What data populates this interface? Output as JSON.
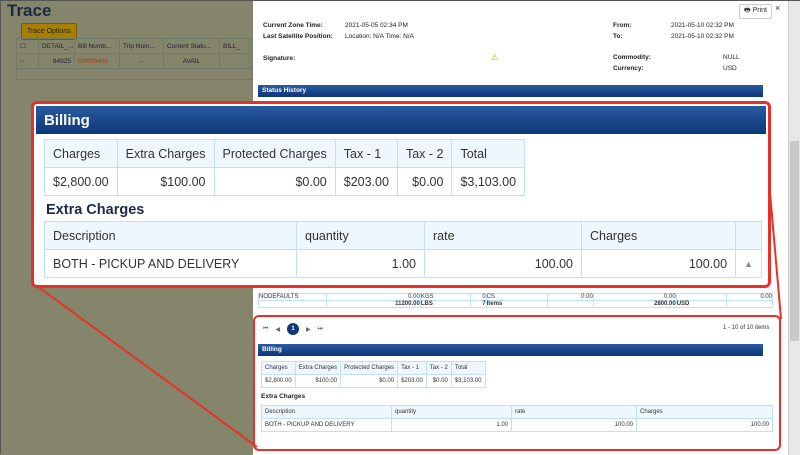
{
  "trace": {
    "title": "Trace",
    "options_button": "Trace Options",
    "columns": [
      "DETAIL_...",
      "Bill Numb...",
      "Trip Num...",
      "Current Statu...",
      "BILL_"
    ],
    "row": [
      "84925",
      "D0000408",
      "-",
      "AVAIL"
    ]
  },
  "modal": {
    "print": "Print",
    "close": "×",
    "details": {
      "current_zone_time_label": "Current Zone Time:",
      "current_zone_time": "2021-05-05 02:34 PM",
      "last_sat_label": "Last Satellite Position:",
      "last_sat": "Location: N/A Time: N/A",
      "from_label": "From:",
      "from": "2021-05-10 02:32 PM",
      "to_label": "To:",
      "to": "2021-05-10 02:32 PM",
      "signature_label": "Signature:",
      "commodity_label": "Commodity:",
      "commodity": "NULL",
      "currency_label": "Currency:",
      "currency": "USD"
    },
    "status_history": {
      "title": "Status History",
      "rows": [
        [
          "NODEFAULTS",
          "0.00",
          "KGS",
          "0",
          "CS",
          "0.00",
          "0.00",
          "",
          "0.00"
        ],
        [
          "",
          "11200.00",
          "LBS",
          "7",
          "Items",
          "",
          "2800.00",
          "USD",
          ""
        ]
      ]
    },
    "pager": {
      "page": "1",
      "summary": "1 - 10 of 10 items"
    }
  },
  "billing": {
    "title": "Billing",
    "headers": [
      "Charges",
      "Extra Charges",
      "Protected Charges",
      "Tax - 1",
      "Tax - 2",
      "Total"
    ],
    "values": [
      "$2,800.00",
      "$100.00",
      "$0.00",
      "$203.00",
      "$0.00",
      "$3,103.00"
    ],
    "extra_title": "Extra Charges",
    "extra_headers": [
      "Description",
      "quantity",
      "rate",
      "Charges"
    ],
    "extra_row": [
      "BOTH - PICKUP AND DELIVERY",
      "1.00",
      "100.00",
      "100.00"
    ]
  },
  "colors": {
    "header": "#0d3777",
    "callout": "#e8302a"
  }
}
